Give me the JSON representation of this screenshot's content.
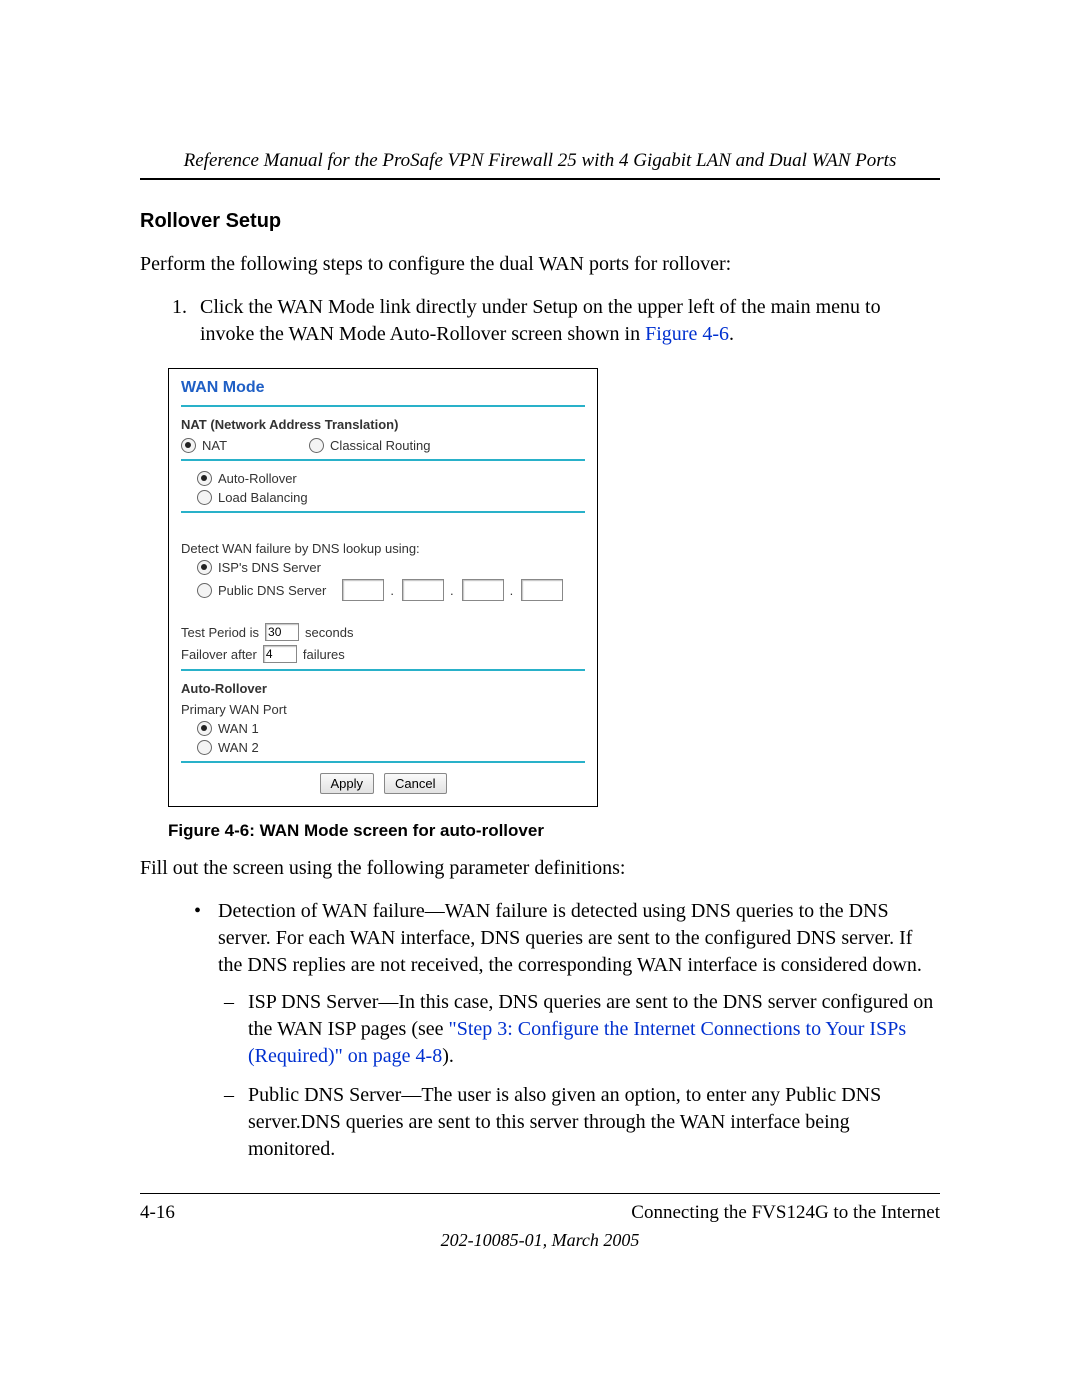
{
  "header": {
    "running_title": "Reference Manual for the ProSafe VPN Firewall 25 with 4 Gigabit LAN and Dual WAN Ports"
  },
  "section": {
    "title": "Rollover Setup",
    "intro": "Perform the following steps to configure the dual WAN ports for rollover:",
    "step1_a": "Click the WAN Mode link directly under Setup on the upper left of the main menu to invoke the WAN Mode Auto-Rollover screen shown in ",
    "step1_link": "Figure 4-6",
    "step1_b": "."
  },
  "figure": {
    "panel_title": "WAN Mode",
    "nat_heading": "NAT (Network Address Translation)",
    "nat_option": "NAT",
    "classical_option": "Classical Routing",
    "auto_rollover": "Auto-Rollover",
    "load_balancing": "Load Balancing",
    "detect_label": "Detect WAN failure by DNS lookup using:",
    "isp_dns": "ISP's DNS Server",
    "public_dns": "Public DNS Server",
    "test_period_pre": "Test Period is",
    "test_period_value": "30",
    "test_period_post": "seconds",
    "failover_pre": "Failover after",
    "failover_value": "4",
    "failover_post": "failures",
    "auto_rollover_heading": "Auto-Rollover",
    "primary_wan_label": "Primary WAN Port",
    "wan1": "WAN 1",
    "wan2": "WAN 2",
    "apply": "Apply",
    "cancel": "Cancel",
    "caption": "Figure 4-6:  WAN Mode screen for auto-rollover"
  },
  "after": {
    "lead": "Fill out the screen using the following parameter definitions:",
    "bullet1": "Detection of WAN failure—WAN failure is detected using DNS queries to the DNS server. For each WAN interface, DNS queries are sent to the configured DNS server. If the DNS replies are not received, the corresponding WAN interface is considered down.",
    "dash1_a": "ISP DNS Server—In this case, DNS queries are sent to the DNS server configured on the WAN ISP pages (see ",
    "dash1_link": "\"Step 3: Configure the Internet Connections to Your ISPs (Required)\" on page 4-8",
    "dash1_b": ").",
    "dash2": "Public DNS Server—The user is also given an option, to enter any Public DNS server.DNS queries are sent to this server through the WAN interface being monitored."
  },
  "footer": {
    "page": "4-16",
    "chapter": "Connecting the FVS124G to the Internet",
    "docnum": "202-10085-01, March 2005"
  }
}
